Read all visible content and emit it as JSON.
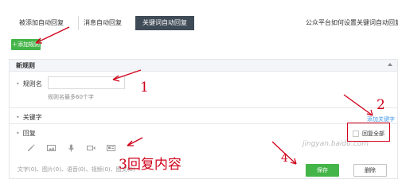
{
  "tabs": [
    {
      "label": "被添加自动回复",
      "active": false
    },
    {
      "label": "消息自动回复",
      "active": false
    },
    {
      "label": "关键词自动回复",
      "active": true
    }
  ],
  "help_link": "公众平台如何设置关键词自动回复",
  "add_rule_button": "＋添加规则",
  "panel": {
    "title": "新规则",
    "rule_name_label": "规则名",
    "rule_name_value": "",
    "rule_name_hint": "规则名最多60个字",
    "keyword_label": "关键字",
    "add_keyword_link": "添加关键字",
    "reply_label": "回复",
    "reply_all_label": "回复全部",
    "reply_all_checked": false,
    "toolbar_icons": [
      "pencil-icon",
      "image-icon",
      "microphone-icon",
      "video-icon",
      "news-icon"
    ],
    "reply_stats": "文字(0)、图片(0)、语音(0)、视频(0)、图文(0)",
    "save_button": "保存",
    "delete_button": "删除"
  },
  "annotations": {
    "a1": "1",
    "a2": "2",
    "a3": "3回复内容",
    "a4": "4"
  },
  "watermark": "jingyan.baidu.com",
  "colors": {
    "brand_green": "#44b549",
    "tab_active_bg": "#3f4b57",
    "link_blue": "#459ae9",
    "annotation_red": "#d0021b"
  }
}
